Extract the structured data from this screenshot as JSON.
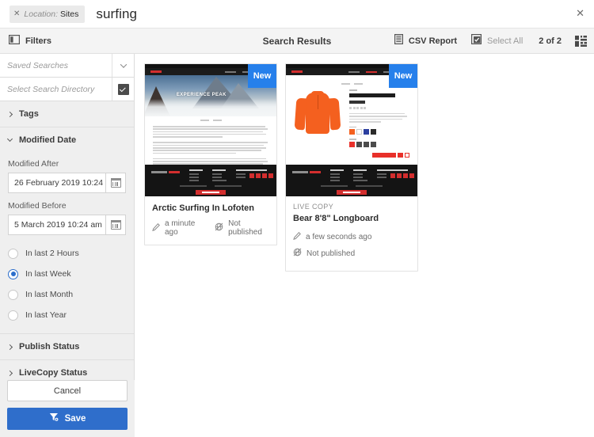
{
  "topbar": {
    "location_key": "Location:",
    "location_value": "Sites",
    "remove_tag": "✕",
    "search_term": "surfing",
    "close": "✕"
  },
  "toolbar": {
    "filters_label": "Filters",
    "title": "Search Results",
    "csv_report_label": "CSV Report",
    "select_all_label": "Select All",
    "count_label": "2 of 2"
  },
  "sidebar": {
    "saved_searches_placeholder": "Saved Searches",
    "search_directory_placeholder": "Select Search Directory",
    "sections": [
      {
        "label": "Tags",
        "expanded": false
      },
      {
        "label": "Modified Date",
        "expanded": true
      },
      {
        "label": "Publish Status",
        "expanded": false
      },
      {
        "label": "LiveCopy Status",
        "expanded": false
      }
    ],
    "modified_after_label": "Modified After",
    "modified_after_value": "26 February 2019 10:24 am",
    "modified_before_label": "Modified Before",
    "modified_before_value": "5 March 2019 10:24 am",
    "radios": [
      {
        "label": "In last 2 Hours",
        "selected": false
      },
      {
        "label": "In last Week",
        "selected": true
      },
      {
        "label": "In last Month",
        "selected": false
      },
      {
        "label": "In last Year",
        "selected": false
      }
    ],
    "cancel_label": "Cancel",
    "save_label": "Save"
  },
  "results": {
    "cards": [
      {
        "badge": "New",
        "live_copy": "",
        "title": "Arctic Surfing In Lofoten",
        "modified": "a minute ago",
        "publish_status": "Not published",
        "hero_text": "EXPERIENCE PEAK"
      },
      {
        "badge": "New",
        "live_copy": "LIVE COPY",
        "title": "Bear 8'8\" Longboard",
        "modified": "a few seconds ago",
        "publish_status": "Not published",
        "hero_text": ""
      }
    ]
  },
  "colors": {
    "accent_blue": "#2680EB",
    "save_blue": "#2F6ECB",
    "radio_blue": "#2C6ECB",
    "brand_red": "#D32E2E",
    "jacket_orange": "#F4601F"
  }
}
